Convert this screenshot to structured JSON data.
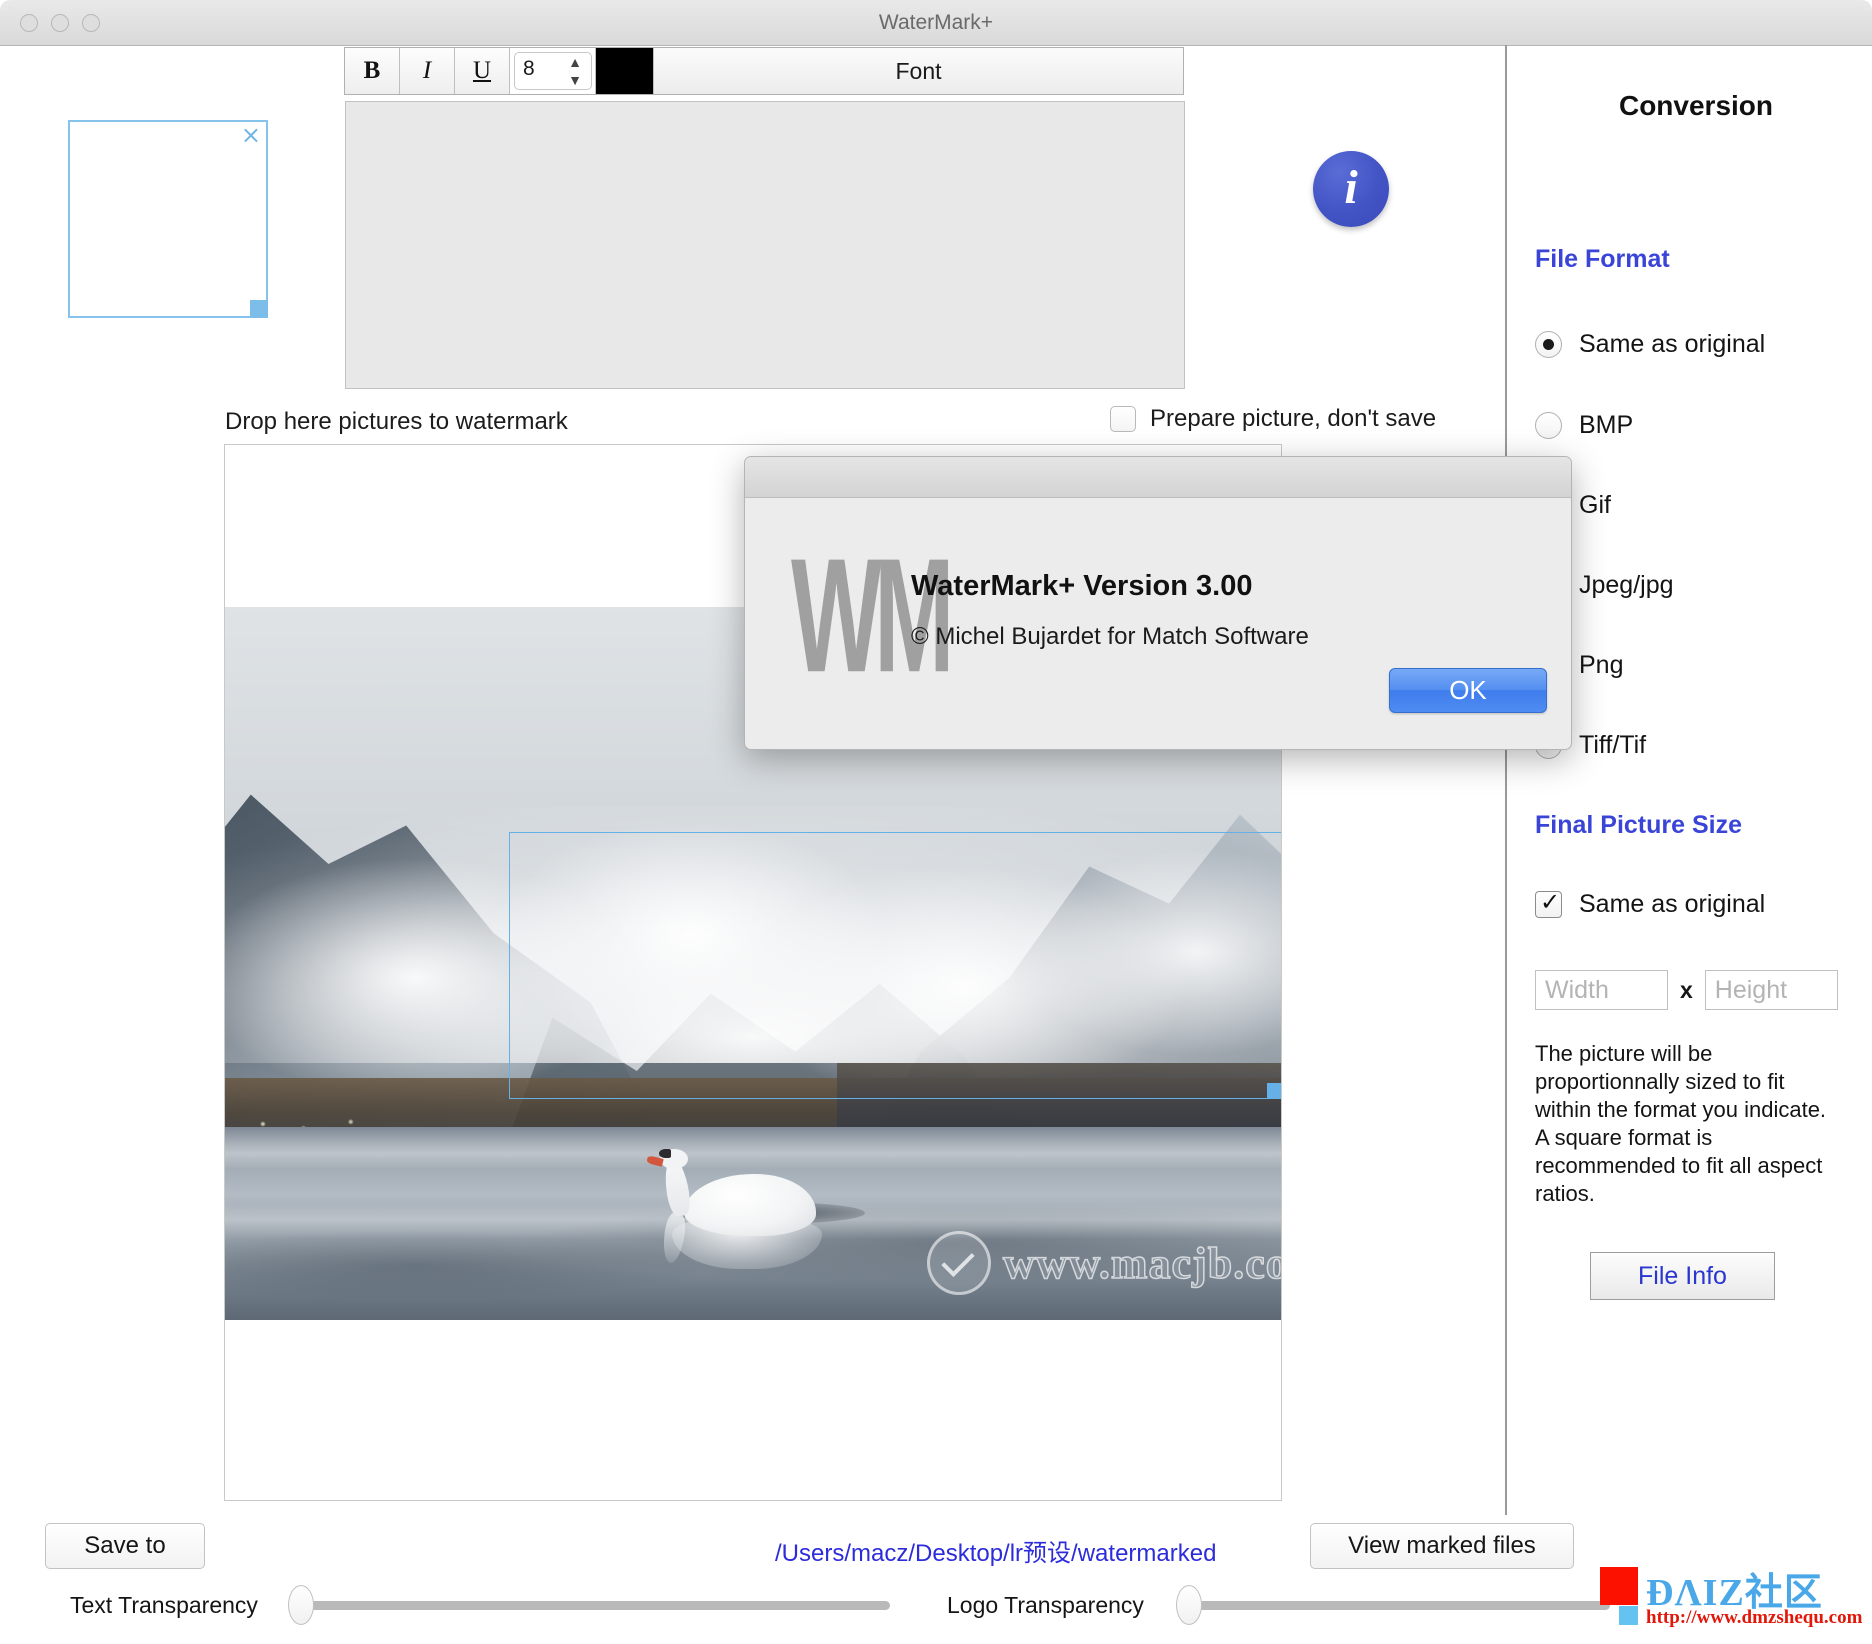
{
  "window": {
    "title": "WaterMark+",
    "traffic_lights": [
      "close",
      "minimize",
      "maximize"
    ]
  },
  "font_toolbar": {
    "bold_label": "B",
    "italic_label": "I",
    "underline_label": "U",
    "size_value": "8",
    "color_swatch_hex": "#000000",
    "font_button_label": "Font"
  },
  "logo_drop": {
    "clear_icon": "×"
  },
  "info_button": {
    "glyph": "i"
  },
  "drop_area": {
    "label": "Drop here pictures to watermark",
    "prepare_checkbox_label": "Prepare picture, don't save",
    "prepare_checked": false
  },
  "preview": {
    "watermark_overlay_text": "www.macjb.com"
  },
  "sidebar": {
    "title": "Conversion",
    "file_format": {
      "heading": "File Format",
      "options": [
        {
          "label": "Same as original",
          "selected": true
        },
        {
          "label": "BMP",
          "selected": false
        },
        {
          "label": "Gif",
          "selected": false
        },
        {
          "label": "Jpeg/jpg",
          "selected": false
        },
        {
          "label": "Png",
          "selected": false
        },
        {
          "label": "Tiff/Tif",
          "selected": false
        }
      ]
    },
    "final_picture_size": {
      "heading": "Final Picture Size",
      "same_as_original_label": "Same as original",
      "same_as_original_checked": true,
      "width_placeholder": "Width",
      "height_placeholder": "Height",
      "separator": "x",
      "help_text": "The picture will be proportionnally sized to fit within the format you indicate. A square format is recommended to fit all aspect ratios.",
      "file_info_button_label": "File Info"
    },
    "accent_color": "#3a45d8"
  },
  "bottom_bar": {
    "save_to_label": "Save to",
    "save_path": "/Users/macz/Desktop/lr预设/watermarked",
    "view_marked_files_label": "View marked files",
    "text_transparency_label": "Text Transparency",
    "logo_transparency_label": "Logo Transparency",
    "text_transparency_value": 0,
    "logo_transparency_value": 0
  },
  "dmz_watermark": {
    "title": "ĐΛIZ社区",
    "url": "http://www.dmzshequ.com"
  },
  "about_dialog": {
    "logo_text": "WM",
    "version_line": "WaterMark+ Version 3.00",
    "copyright_line": "© Michel Bujardet for Match Software",
    "ok_label": "OK"
  }
}
